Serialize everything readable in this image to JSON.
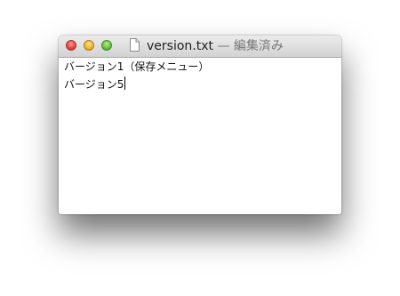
{
  "window": {
    "filename": "version.txt",
    "status": " — 編集済み"
  },
  "document": {
    "lines": [
      "バージョン1（保存メニュー）",
      "バージョン5"
    ]
  }
}
